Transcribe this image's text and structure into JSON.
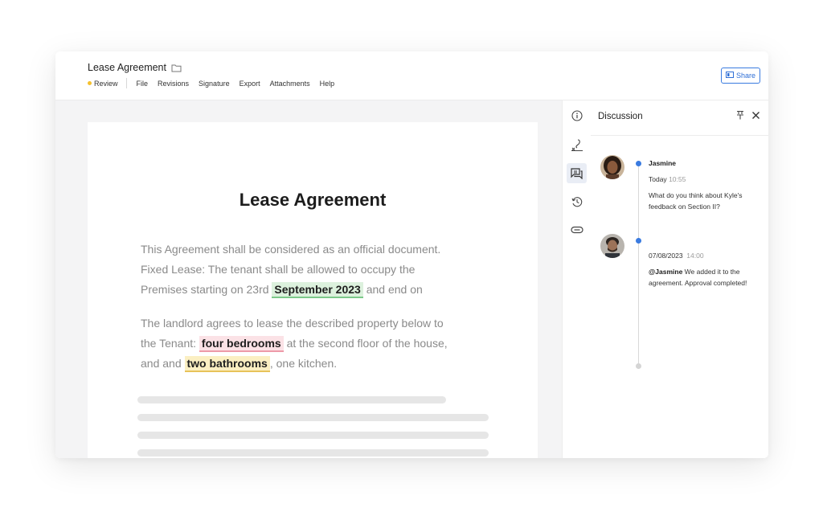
{
  "header": {
    "title": "Lease Agreement",
    "status": "Review",
    "menu": [
      "File",
      "Revisions",
      "Signature",
      "Export",
      "Attachments",
      "Help"
    ],
    "share_label": "Share"
  },
  "document": {
    "title": "Lease Agreement",
    "para1": {
      "line1": "This Agreement shall be considered as an official document.",
      "line2": "Fixed Lease: The tenant shall be allowed to occupy the",
      "line3_before": "Premises starting on 23rd ",
      "highlight": "September 2023",
      "line3_after": " and end on"
    },
    "para2": {
      "line1": "The landlord agrees to lease the described property below to",
      "line2_before": "the Tenant: ",
      "highlight1": "four bedrooms",
      "line2_after": " at the second floor of the house,",
      "line3_before": "and and ",
      "highlight2": "two bathrooms",
      "line3_after": ", one kitchen."
    }
  },
  "toolrail": {
    "icons": [
      "info-icon",
      "signature-icon",
      "discussion-icon",
      "history-icon",
      "attachment-icon"
    ],
    "active": "discussion-icon"
  },
  "discussion": {
    "title": "Discussion",
    "comments": [
      {
        "name": "Jasmine",
        "day": "Today",
        "time": "10:55",
        "text": "What do you think about Kyle's feedback on Section II?"
      },
      {
        "date": "07/08/2023",
        "time": "14:00",
        "mention": "@Jasmine",
        "text": " We added it to the agreement. Approval completed!"
      }
    ]
  },
  "colors": {
    "accent": "#3a7be0",
    "status_dot": "#f5c12e",
    "highlight_green": "#dcf1dd",
    "highlight_pink": "#fbe2e6",
    "highlight_yellow": "#fbefc2"
  }
}
